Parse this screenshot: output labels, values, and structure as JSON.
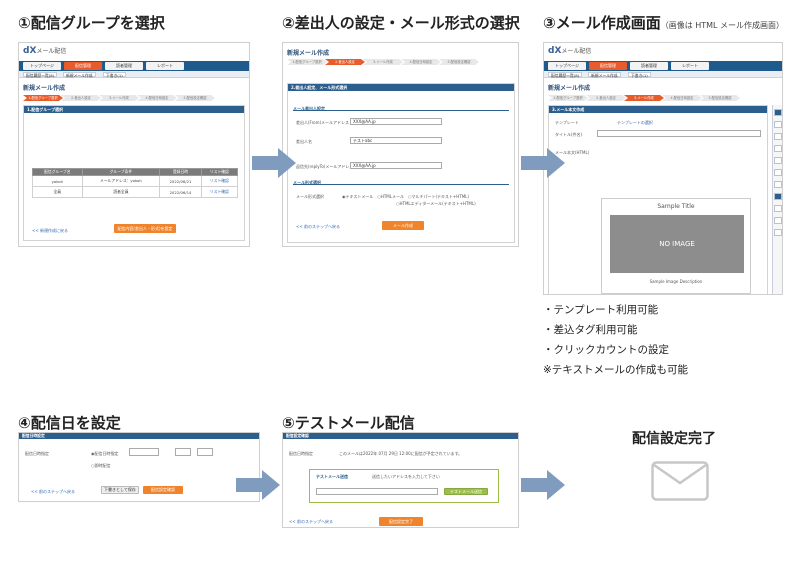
{
  "steps": {
    "s1": {
      "title": "①配信グループを選択"
    },
    "s2": {
      "title": "②差出人の設定・メール形式の選択"
    },
    "s3": {
      "title": "③メール作成画面",
      "note": "（画像は HTML メール作成画面）"
    },
    "s4": {
      "title": "④配信日を設定"
    },
    "s5": {
      "title": "⑤テストメール配信"
    },
    "done": {
      "title": "配信設定完了"
    }
  },
  "features": [
    "・テンプレート利用可能",
    "・差込タグ利用可能",
    "・クリックカウントの設定",
    "※テキストメールの作成も可能"
  ],
  "ui": {
    "brand": "dX",
    "brand_suffix": "メール配信",
    "nav": [
      "トップページ",
      "配信管理",
      "読者管理",
      "レポート"
    ],
    "sub": [
      "配信履歴一覧(8)",
      "新規メール作成",
      "下書き(1)"
    ],
    "page_title": "新規メール作成",
    "progress": [
      "1.配信グループ選択",
      "2.差出人設定",
      "3.メール作成",
      "4.配信日時設定",
      "5.配信設定確認"
    ],
    "s1_panel_head": "1.配信グループ選択",
    "s1_table_head": [
      "配信グループ名",
      "グループ条件",
      "登録日時",
      "リスト確認"
    ],
    "s1_rows": [
      [
        "yokoh",
        "メールアドレス：yokoh",
        "2022/06/21",
        "リスト確認"
      ],
      [
        "全員",
        "読者全員",
        "2022/06/14",
        "リスト確認"
      ]
    ],
    "s1_link_back": "<< 新規作成に戻る",
    "s1_button": "配信内容(差出人・形式)を設定",
    "s2_panel_head": "2.差出人設定、メール形式選択",
    "s2_sect1": "メール差出人設定",
    "s2_label_from": "差出人(From)メールアドレス",
    "s2_val_from": "XXX@AA.jp",
    "s2_label_name": "差出人名",
    "s2_val_name": "テストabc",
    "s2_label_reply": "返信先(replyTo)メールアドレス",
    "s2_val_reply": "XXX@AA.jp",
    "s2_sect2": "メール形式選択",
    "s2_label_format": "メール形式選択",
    "s2_formats": "◉テキストメール　○HTMLメール　○マルチパート(テキスト+HTML)",
    "s2_format2": "○HTMLエディターメール(テキスト+HTML)",
    "s2_link_back": "<< 前のステップへ戻る",
    "s2_button": "メール作成",
    "s3_panel_head": "3.メール本文作成",
    "s3_label_template": "テンプレート",
    "s3_template_link": "テンプレートの選択",
    "s3_label_title": "タイトル(件名)",
    "s3_label_body": "メール本文(HTML)",
    "s3_sample_title": "Sample Title",
    "s3_noimage": "NO IMAGE",
    "s3_caption": "Sample Image Description",
    "s4_panel_head": "配信日時設定",
    "s4_label": "配信日時指定",
    "s4_opt1": "◉配信日時指定",
    "s4_opt2": "○即時配信",
    "s4_link_back": "<< 前のステップへ戻る",
    "s4_btn_draft": "下書きとして保存",
    "s4_btn_confirm": "配信設定確認",
    "s5_panel_head": "配信設定確認",
    "s5_label": "配信日時指定",
    "s5_text": "このメールは2022年 07月 29日 12:00に配信が予定されています。",
    "s5_box_title": "テストメール送信",
    "s5_box_text": "送信したいアドレスを入力して下さい",
    "s5_btn_test": "テストメール送信",
    "s5_link_back": "<< 前のステップへ戻る",
    "s5_button": "配信設定完了"
  },
  "colors": {
    "arrow": "#7f9bbd",
    "nav": "#1e5b8c",
    "accent": "#e85c2b",
    "button": "#f0842c"
  }
}
